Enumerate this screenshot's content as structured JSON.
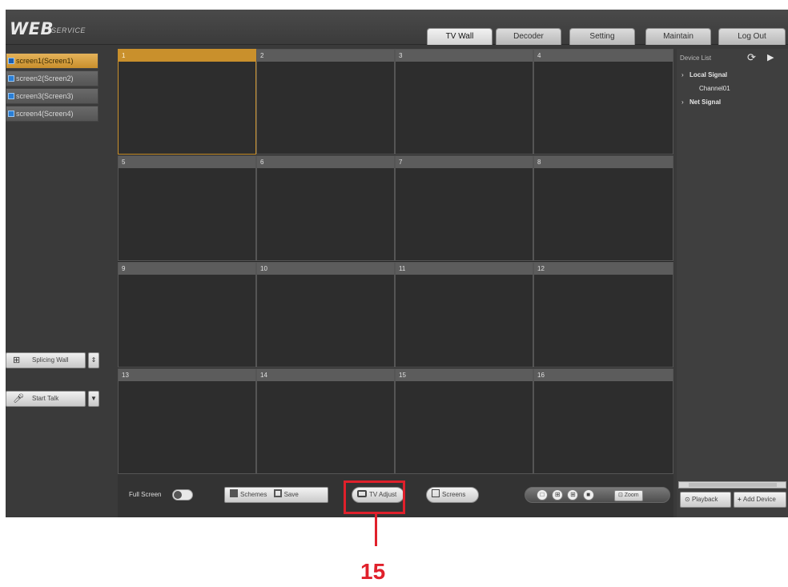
{
  "header": {
    "logo": "WEB",
    "logo_sub": "SERVICE",
    "tabs": [
      {
        "label": "TV Wall",
        "active": true
      },
      {
        "label": "Decoder",
        "active": false
      },
      {
        "label": "Setting",
        "active": false
      },
      {
        "label": "Maintain",
        "active": false
      },
      {
        "label": "Log Out",
        "active": false
      }
    ]
  },
  "screens": [
    {
      "label": "screen1(Screen1)",
      "active": true
    },
    {
      "label": "screen2(Screen2)",
      "active": false
    },
    {
      "label": "screen3(Screen3)",
      "active": false
    },
    {
      "label": "screen4(Screen4)",
      "active": false
    }
  ],
  "controls": {
    "splicing_wall": "Splicing Wall",
    "start_talk": "Start Talk"
  },
  "grid": {
    "cells": [
      "1",
      "2",
      "3",
      "4",
      "5",
      "6",
      "7",
      "8",
      "9",
      "10",
      "11",
      "12",
      "13",
      "14",
      "15",
      "16"
    ],
    "active_cell": "1"
  },
  "bottom_bar": {
    "full_screen": "Full Screen",
    "schemes": "Schemes",
    "save": "Save",
    "tv_adjust": "TV Adjust",
    "screens": "Screens",
    "zoom": "Zoom"
  },
  "device_list": {
    "title": "Device List",
    "local_signal": "Local Signal",
    "channel": "Channel01",
    "net_signal": "Net Signal",
    "playback": "Playback",
    "add_device": "Add Device"
  },
  "annotation": {
    "label": "15",
    "color": "#e0202b"
  },
  "colors": {
    "accent": "#c9902c",
    "background": "#3a3a3a"
  }
}
